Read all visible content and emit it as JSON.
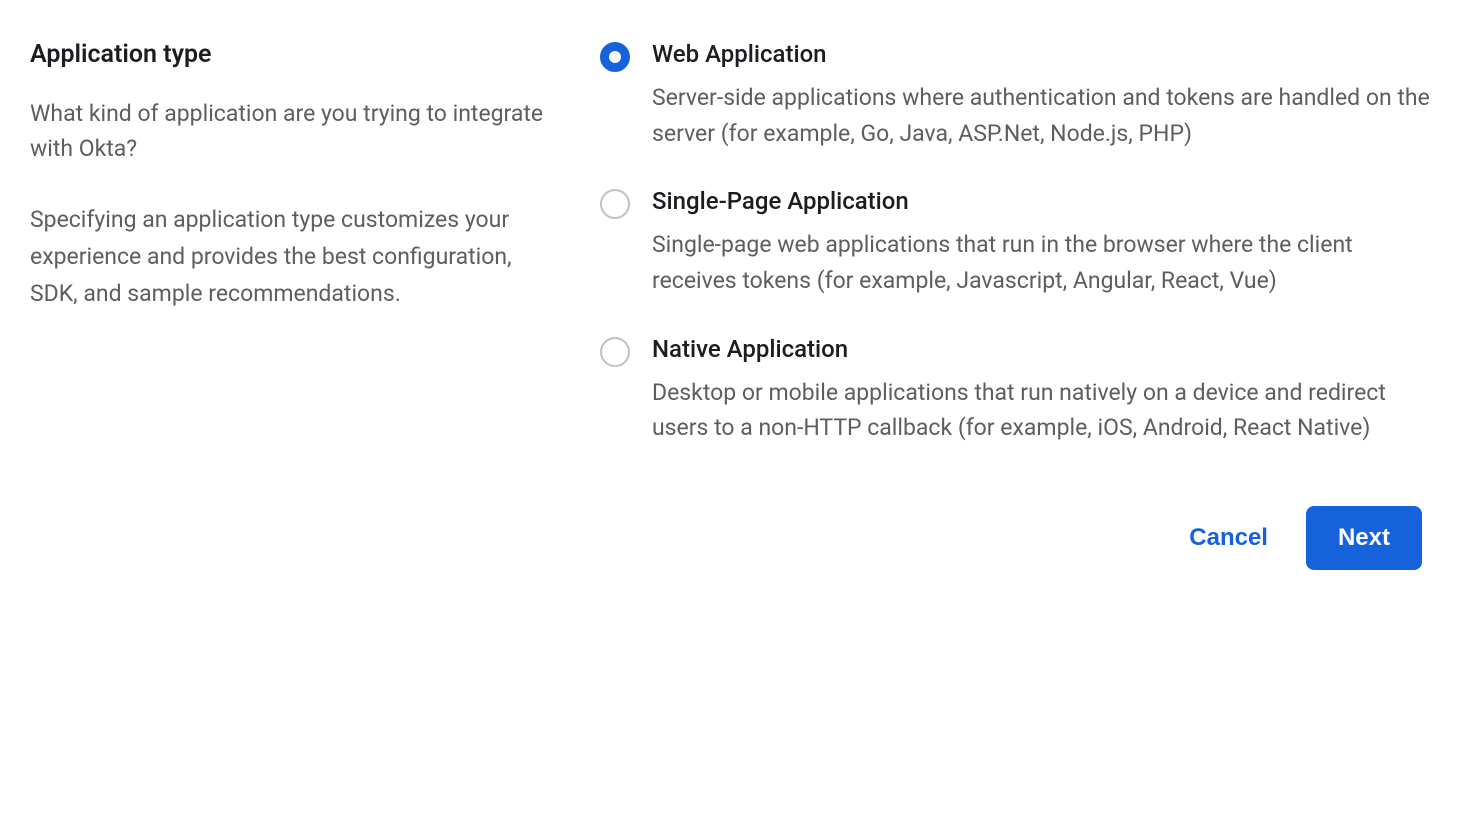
{
  "section": {
    "title": "Application type",
    "question": "What kind of application are you trying to integrate with Okta?",
    "explain": "Specifying an application type customizes your experience and provides the best configuration, SDK, and sample recommendations."
  },
  "options": [
    {
      "label": "Web Application",
      "desc": "Server-side applications where authentication and tokens are handled on the server (for example, Go, Java, ASP.Net, Node.js, PHP)",
      "selected": true
    },
    {
      "label": "Single-Page Application",
      "desc": "Single-page web applications that run in the browser where the client receives tokens (for example, Javascript, Angular, React, Vue)",
      "selected": false
    },
    {
      "label": "Native Application",
      "desc": "Desktop or mobile applications that run natively on a device and redirect users to a non-HTTP callback (for example, iOS, Android, React Native)",
      "selected": false
    }
  ],
  "buttons": {
    "cancel": "Cancel",
    "next": "Next"
  }
}
